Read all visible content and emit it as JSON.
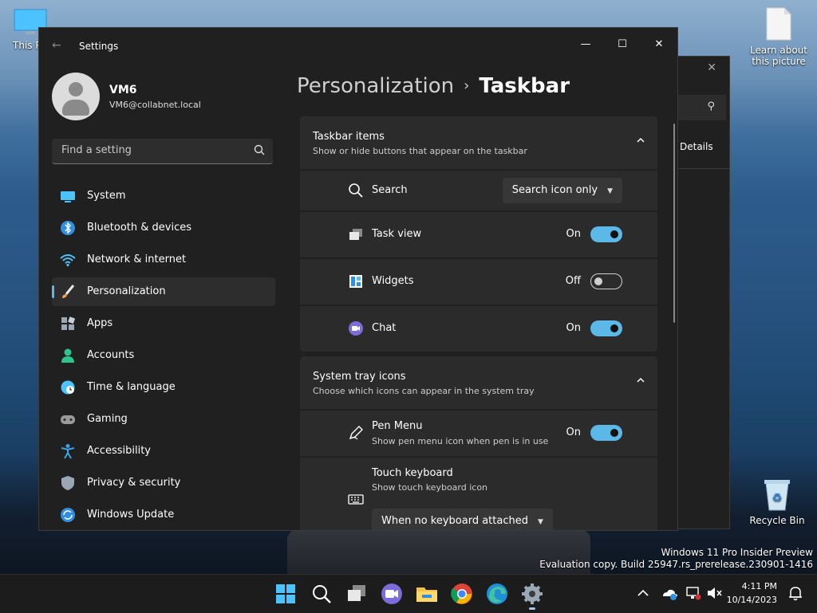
{
  "desktop": {
    "this_pc_label": "This PC",
    "learn_label": "Learn about this picture",
    "recycle_label": "Recycle Bin"
  },
  "bg_window": {
    "details_label": "Details"
  },
  "window": {
    "title": "Settings",
    "back_label": "←",
    "min_label": "—",
    "max_label": "☐",
    "close_label": "✕"
  },
  "user": {
    "name": "VM6",
    "email": "VM6@collabnet.local"
  },
  "search": {
    "placeholder": "Find a setting",
    "icon": "search-icon"
  },
  "nav": [
    {
      "label": "System",
      "icon": "monitor-icon",
      "color": "#4cc2ff"
    },
    {
      "label": "Bluetooth & devices",
      "icon": "bluetooth-icon",
      "color": "#2f8fe0"
    },
    {
      "label": "Network & internet",
      "icon": "wifi-icon",
      "color": "#4cc2ff"
    },
    {
      "label": "Personalization",
      "icon": "brush-icon",
      "color": "#f0a050",
      "active": true
    },
    {
      "label": "Apps",
      "icon": "apps-icon",
      "color": "#9aa7b5"
    },
    {
      "label": "Accounts",
      "icon": "person-icon",
      "color": "#2fc48d"
    },
    {
      "label": "Time & language",
      "icon": "globe-clock-icon",
      "color": "#4cc2ff"
    },
    {
      "label": "Gaming",
      "icon": "gamepad-icon",
      "color": "#9a9a9a"
    },
    {
      "label": "Accessibility",
      "icon": "accessibility-icon",
      "color": "#3ba3e8"
    },
    {
      "label": "Privacy & security",
      "icon": "shield-icon",
      "color": "#9aa7b5"
    },
    {
      "label": "Windows Update",
      "icon": "update-icon",
      "color": "#2f8fe0"
    }
  ],
  "breadcrumb": {
    "parent": "Personalization",
    "separator": "›",
    "current": "Taskbar"
  },
  "taskbar_items": {
    "title": "Taskbar items",
    "subtitle": "Show or hide buttons that appear on the taskbar",
    "rows": {
      "search": {
        "label": "Search",
        "dropdown": "Search icon only"
      },
      "taskview": {
        "label": "Task view",
        "state": "On",
        "on": true
      },
      "widgets": {
        "label": "Widgets",
        "state": "Off",
        "on": false
      },
      "chat": {
        "label": "Chat",
        "state": "On",
        "on": true
      }
    }
  },
  "system_tray": {
    "title": "System tray icons",
    "subtitle": "Choose which icons can appear in the system tray",
    "pen": {
      "label": "Pen Menu",
      "sub": "Show pen menu icon when pen is in use",
      "state": "On",
      "on": true
    },
    "touch": {
      "label": "Touch keyboard",
      "sub": "Show touch keyboard icon",
      "dropdown": "When no keyboard attached"
    }
  },
  "watermark": {
    "line1": "Windows 11 Pro Insider Preview",
    "line2": "Evaluation copy. Build 25947.rs_prerelease.230901-1416"
  },
  "taskbar": {
    "time": "4:11 PM",
    "date": "10/14/2023",
    "tray_chevron": "^"
  }
}
